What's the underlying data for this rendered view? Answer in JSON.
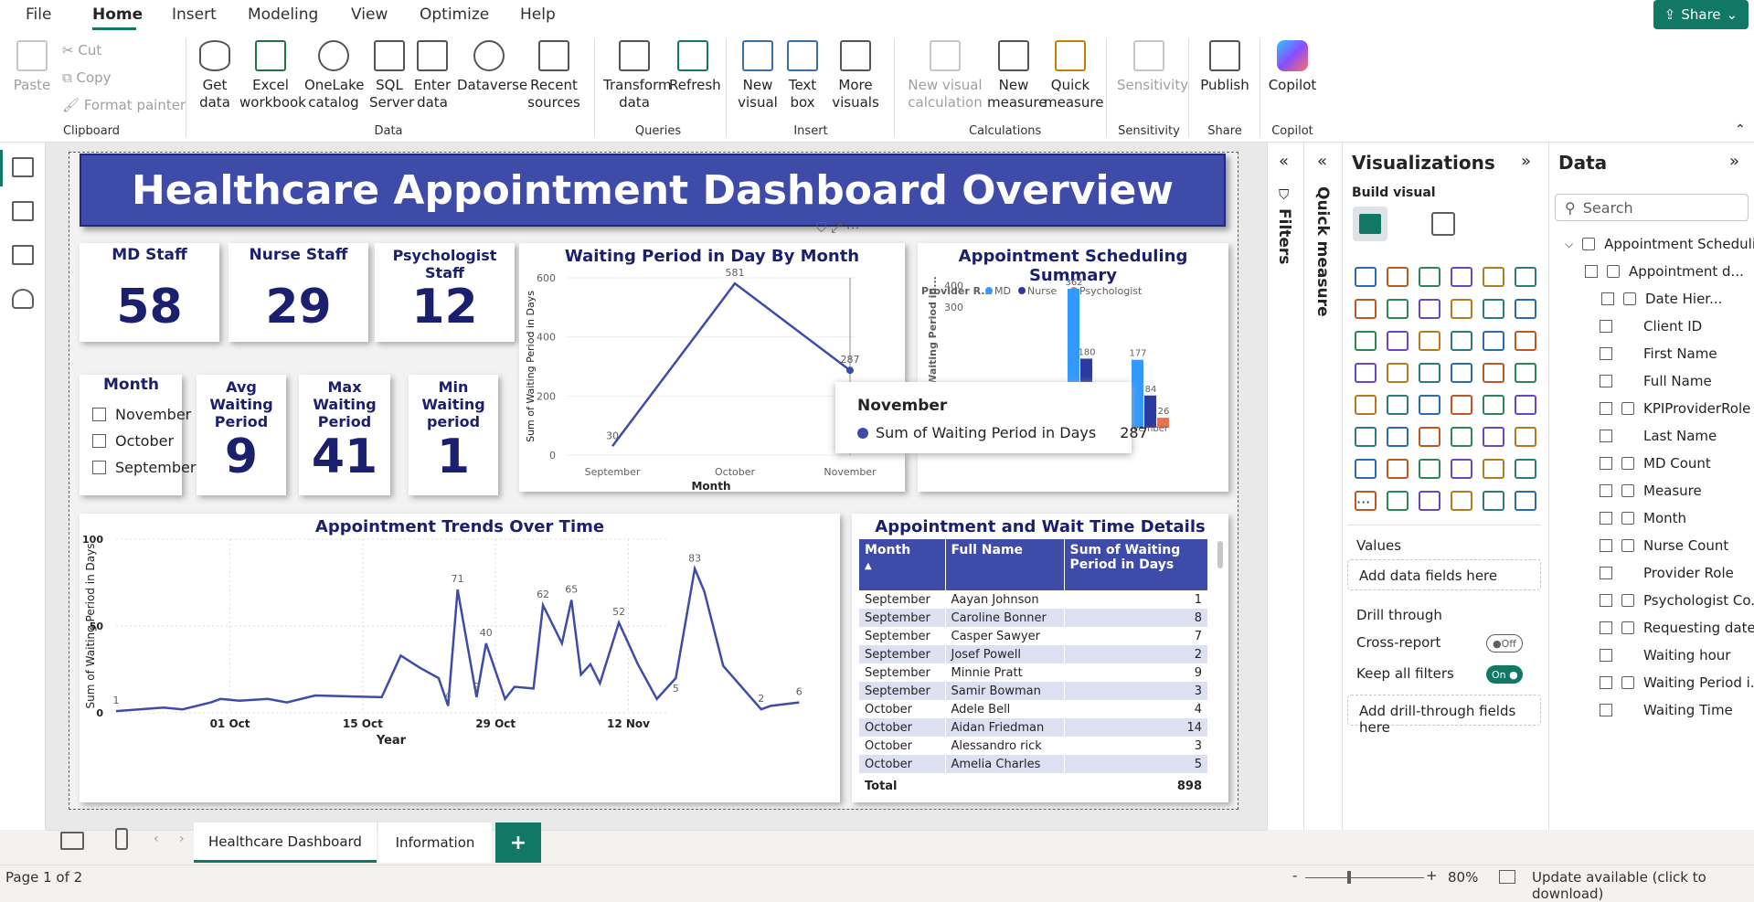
{
  "menu": {
    "items": [
      "File",
      "Home",
      "Insert",
      "Modeling",
      "View",
      "Optimize",
      "Help"
    ],
    "share": "Share"
  },
  "ribbon": {
    "clipboard": {
      "paste": "Paste",
      "cut": "Cut",
      "copy": "Copy",
      "format_painter": "Format painter",
      "group": "Clipboard"
    },
    "data": {
      "get_data": "Get data",
      "excel": "Excel workbook",
      "onelake": "OneLake catalog",
      "sql": "SQL Server",
      "enter": "Enter data",
      "dataverse": "Dataverse",
      "recent": "Recent sources",
      "group": "Data"
    },
    "queries": {
      "transform": "Transform data",
      "refresh": "Refresh",
      "group": "Queries"
    },
    "insert": {
      "new_visual": "New visual",
      "text_box": "Text box",
      "more_visuals": "More visuals",
      "group": "Insert"
    },
    "calculations": {
      "new_visual_calc": "New visual calculation",
      "new_measure": "New measure",
      "quick_measure": "Quick measure",
      "group": "Calculations"
    },
    "sensitivity": {
      "label": "Sensitivity",
      "group": "Sensitivity"
    },
    "share": {
      "publish": "Publish",
      "group": "Share"
    },
    "copilot": {
      "label": "Copilot",
      "group": "Copilot"
    }
  },
  "dashboard": {
    "title": "Healthcare Appointment Dashboard Overview",
    "kpis": [
      {
        "label": "MD Staff",
        "value": "58"
      },
      {
        "label": "Nurse Staff",
        "value": "29"
      },
      {
        "label": "Psychologist Staff",
        "value": "12"
      },
      {
        "label": "Avg Waiting Period",
        "value": "9"
      },
      {
        "label": "Max Waiting Period",
        "value": "41"
      },
      {
        "label": "Min Waiting period",
        "value": "1"
      }
    ],
    "slicer": {
      "title": "Month",
      "options": [
        "November",
        "October",
        "September"
      ]
    },
    "table": {
      "title": "Appointment and Wait Time Details",
      "headers": [
        "Month",
        "Full Name",
        "Sum of Waiting Period in Days"
      ],
      "rows": [
        [
          "September",
          "Aayan Johnson",
          "1"
        ],
        [
          "September",
          "Caroline Bonner",
          "8"
        ],
        [
          "September",
          "Casper Sawyer",
          "7"
        ],
        [
          "September",
          "Josef Powell",
          "2"
        ],
        [
          "September",
          "Minnie Pratt",
          "9"
        ],
        [
          "September",
          "Samir Bowman",
          "3"
        ],
        [
          "October",
          "Adele Bell",
          "4"
        ],
        [
          "October",
          "Aidan Friedman",
          "14"
        ],
        [
          "October",
          "Alessandro rick",
          "3"
        ],
        [
          "October",
          "Amelia Charles",
          "5"
        ]
      ],
      "total_label": "Total",
      "total_value": "898"
    },
    "tooltip": {
      "title": "November",
      "label": "Sum of Waiting Period in Days",
      "value": "287"
    }
  },
  "chart_data": [
    {
      "type": "line",
      "title": "Waiting Period in Day By Month",
      "xlabel": "Month",
      "ylabel": "Sum of Waiting Period in Days",
      "categories": [
        "September",
        "October",
        "November"
      ],
      "values": [
        30,
        581,
        287
      ],
      "ylim": [
        0,
        600
      ],
      "yticks": [
        "0",
        "200",
        "400",
        "600"
      ]
    },
    {
      "type": "bar",
      "title": "Appointment Scheduling Summary",
      "legend_title": "Provider R...",
      "xlabel": "Month",
      "ylabel": "Waiting Period in...",
      "categories": [
        "September",
        "October",
        "November"
      ],
      "series": [
        {
          "name": "MD",
          "color": "#3399ff",
          "values": [
            null,
            362,
            177
          ]
        },
        {
          "name": "Nurse",
          "color": "#2b3a9e",
          "values": [
            null,
            180,
            84
          ]
        },
        {
          "name": "Psychologist",
          "color": "#e8734a",
          "values": [
            null,
            null,
            26
          ]
        }
      ],
      "ylim": [
        0,
        400
      ],
      "yticks": [
        "300",
        "400"
      ]
    },
    {
      "type": "line",
      "title": "Appointment Trends Over Time",
      "xlabel": "Year",
      "ylabel": "Sum of Waiting Period in Days",
      "xticks": [
        "01 Oct",
        "15 Oct",
        "29 Oct",
        "12 Nov"
      ],
      "yticks": [
        "0",
        "50",
        "100"
      ],
      "ylim": [
        0,
        100
      ],
      "x_range": [
        "2024-09-19",
        "2024-11-16"
      ],
      "points": [
        [
          "2024-09-19",
          1
        ],
        [
          "2024-09-24",
          3
        ],
        [
          "2024-09-26",
          2
        ],
        [
          "2024-09-29",
          6
        ],
        [
          "2024-09-30",
          8
        ],
        [
          "2024-10-02",
          7
        ],
        [
          "2024-10-05",
          8
        ],
        [
          "2024-10-07",
          6
        ],
        [
          "2024-10-10",
          10
        ],
        [
          "2024-10-17",
          9
        ],
        [
          "2024-10-19",
          33
        ],
        [
          "2024-10-21",
          26
        ],
        [
          "2024-10-23",
          20
        ],
        [
          "2024-10-24",
          4
        ],
        [
          "2024-10-25",
          71
        ],
        [
          "2024-10-27",
          9
        ],
        [
          "2024-10-28",
          40
        ],
        [
          "2024-10-30",
          8
        ],
        [
          "2024-10-31",
          15
        ],
        [
          "2024-11-02",
          14
        ],
        [
          "2024-11-03",
          62
        ],
        [
          "2024-11-05",
          40
        ],
        [
          "2024-11-06",
          65
        ],
        [
          "2024-11-07",
          22
        ],
        [
          "2024-11-08",
          28
        ],
        [
          "2024-11-09",
          17
        ],
        [
          "2024-11-11",
          52
        ],
        [
          "2024-11-13",
          28
        ],
        [
          "2024-11-15",
          8
        ],
        [
          "2024-11-17",
          20
        ],
        [
          "2024-11-19",
          83
        ],
        [
          "2024-11-20",
          70
        ],
        [
          "2024-11-22",
          27
        ],
        [
          "2024-11-26",
          2
        ],
        [
          "2024-11-27",
          4
        ],
        [
          "2024-11-30",
          6
        ]
      ],
      "labels": [
        [
          "2024-09-19",
          1,
          "1"
        ],
        [
          "2024-10-25",
          71,
          "71"
        ],
        [
          "2024-10-24",
          4,
          "4"
        ],
        [
          "2024-10-27",
          9,
          "9"
        ],
        [
          "2024-10-28",
          40,
          "40"
        ],
        [
          "2024-11-03",
          62,
          "62"
        ],
        [
          "2024-11-06",
          65,
          "65"
        ],
        [
          "2024-11-11",
          52,
          "52"
        ],
        [
          "2024-11-17",
          8,
          "5"
        ],
        [
          "2024-11-19",
          83,
          "83"
        ],
        [
          "2024-11-26",
          2,
          "2"
        ],
        [
          "2024-11-30",
          6,
          "6"
        ]
      ]
    }
  ],
  "filters": {
    "label": "Filters"
  },
  "quick_measure": {
    "label": "Quick measure"
  },
  "visualizations": {
    "title": "Visualizations",
    "build_visual": "Build visual",
    "values_label": "Values",
    "values_placeholder": "Add data fields here",
    "drill_through": "Drill through",
    "cross_report": "Cross-report",
    "cross_report_state": "Off",
    "keep_filters": "Keep all filters",
    "keep_filters_state": "On",
    "drill_placeholder": "Add drill-through fields here"
  },
  "data_pane": {
    "title": "Data",
    "search_placeholder": "Search",
    "table_name": "Appointment Scheduli...",
    "fields": [
      {
        "name": "Appointment d...",
        "icon": "calendar-icon"
      },
      {
        "name": "Date Hier...",
        "icon": "hierarchy-icon"
      },
      {
        "name": "Client ID",
        "icon": ""
      },
      {
        "name": "First Name",
        "icon": ""
      },
      {
        "name": "Full Name",
        "icon": ""
      },
      {
        "name": "KPIProviderRole",
        "icon": "calc-icon"
      },
      {
        "name": "Last Name",
        "icon": ""
      },
      {
        "name": "MD Count",
        "icon": "calc-icon"
      },
      {
        "name": "Measure",
        "icon": "measure-icon"
      },
      {
        "name": "Month",
        "icon": "calc-icon"
      },
      {
        "name": "Nurse Count",
        "icon": "calc-icon"
      },
      {
        "name": "Provider Role",
        "icon": ""
      },
      {
        "name": "Psychologist Co...",
        "icon": "calc-icon"
      },
      {
        "name": "Requesting date",
        "icon": "calendar-icon"
      },
      {
        "name": "Waiting hour",
        "icon": ""
      },
      {
        "name": "Waiting Period i...",
        "icon": "measure-icon"
      },
      {
        "name": "Waiting Time",
        "icon": ""
      }
    ]
  },
  "tabs": {
    "active": "Healthcare Dashboard",
    "other": "Information",
    "add": "+"
  },
  "status": {
    "page": "Page 1 of 2",
    "zoom": "80%",
    "update": "Update available (click to download)"
  }
}
